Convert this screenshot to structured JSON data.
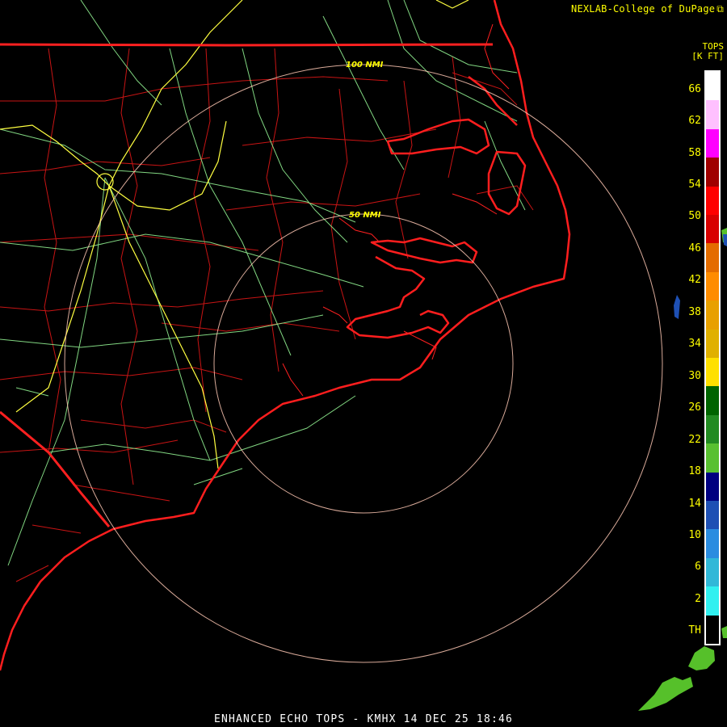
{
  "header": {
    "credit": "NEXLAB-College of DuPage",
    "credit_icon": "external-link-icon"
  },
  "legend": {
    "title_line1": "TOPS",
    "title_line2": "[K FT]",
    "labels": [
      "66",
      "62",
      "58",
      "54",
      "50",
      "46",
      "42",
      "38",
      "34",
      "30",
      "26",
      "22",
      "18",
      "14",
      "10",
      "6",
      "2",
      "TH"
    ],
    "colors": [
      "#ffffff",
      "#ffc0ff",
      "#ff00ff",
      "#a00000",
      "#ff0000",
      "#d80000",
      "#e46c00",
      "#ff8c00",
      "#e8a000",
      "#e0b000",
      "#ffe000",
      "#006400",
      "#228b22",
      "#58c030",
      "#000080",
      "#1e50b4",
      "#2a8ce0",
      "#30b8d8",
      "#30f0f0",
      "#000000"
    ]
  },
  "map": {
    "radar_site": "KMHX",
    "range_rings": [
      {
        "label": "50 NMI"
      },
      {
        "label": "100 NMI"
      }
    ],
    "colors": {
      "state_borders": "#ff2020",
      "county_lines": "#c81414",
      "highways": "#90ee90",
      "interstates": "#ffff40",
      "range_rings": "#ffc8b4",
      "echo_green": "#56c02a",
      "echo_blue": "#1e50b4"
    }
  },
  "footer": {
    "caption": "ENHANCED ECHO TOPS - KMHX 14 DEC 25 18:46"
  }
}
